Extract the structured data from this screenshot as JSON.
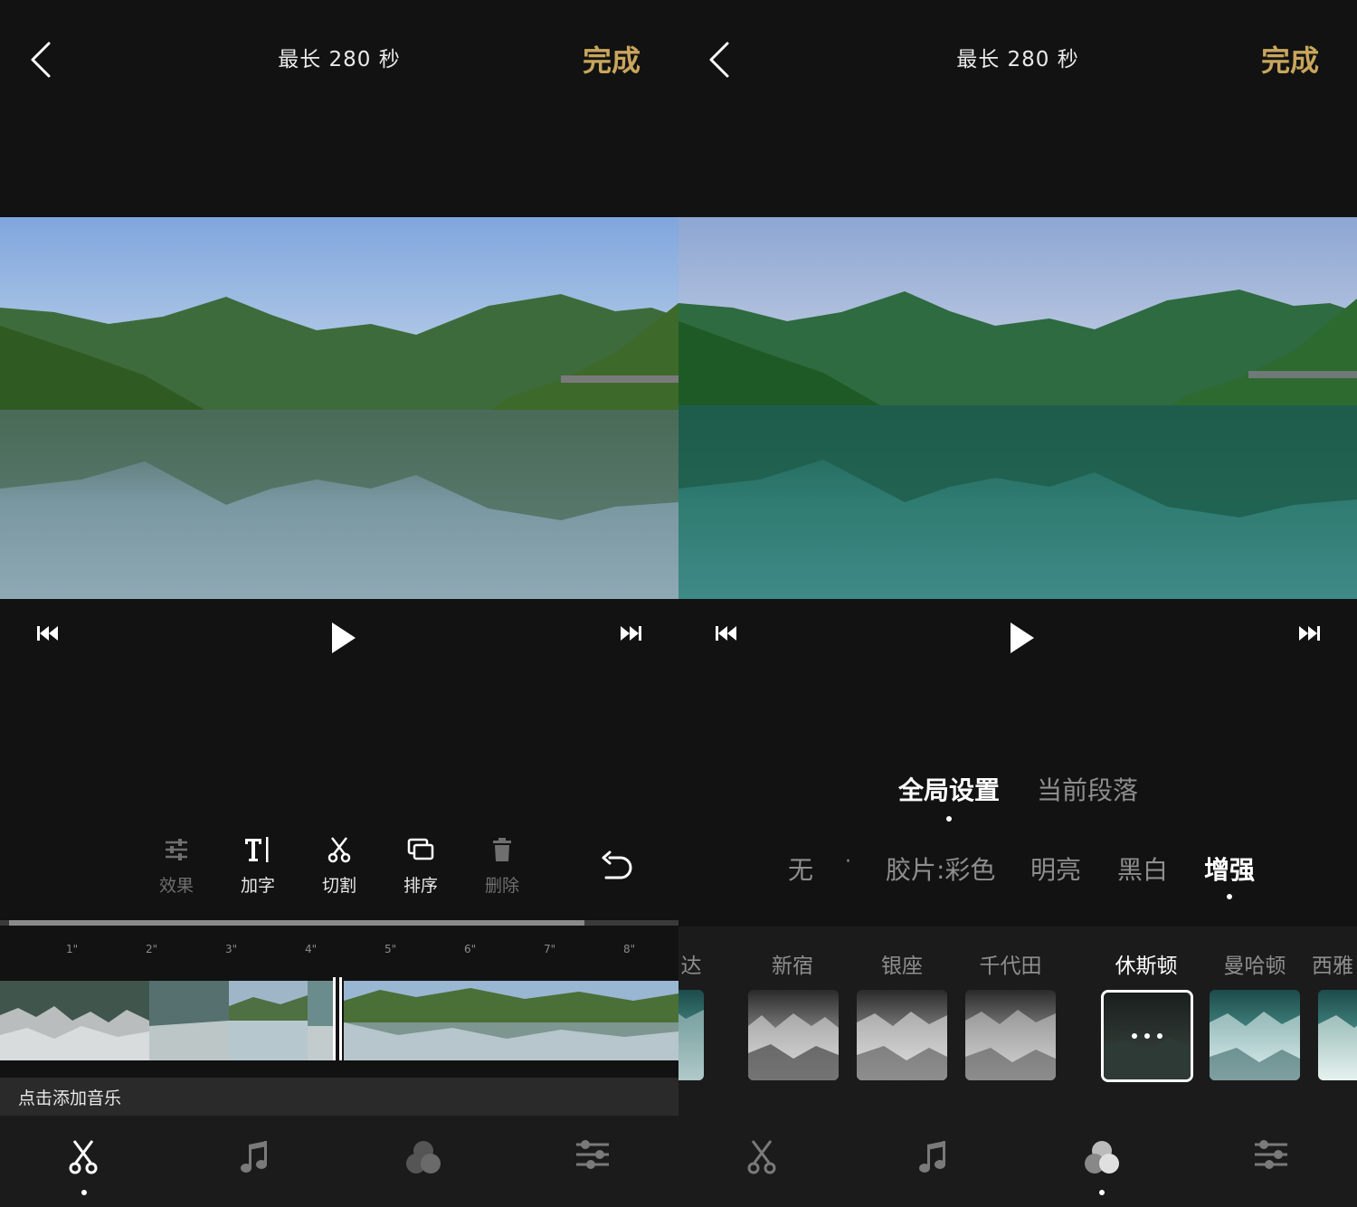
{
  "header": {
    "title": "最长 280 秒",
    "done_label": "完成"
  },
  "editor": {
    "tools": [
      {
        "label": "效果",
        "icon": "sliders-icon",
        "enabled": false
      },
      {
        "label": "加字",
        "icon": "text-cursor-icon",
        "enabled": true
      },
      {
        "label": "切割",
        "icon": "scissors-icon",
        "enabled": true
      },
      {
        "label": "排序",
        "icon": "layers-icon",
        "enabled": true
      },
      {
        "label": "删除",
        "icon": "trash-icon",
        "enabled": false
      }
    ],
    "undo_icon": "undo-icon",
    "timeline": {
      "progress_fraction": 0.86,
      "ruler_ticks": [
        "1\"",
        "2\"",
        "3\"",
        "4\"",
        "5\"",
        "6\"",
        "7\"",
        "8\""
      ]
    },
    "music_hint": "点击添加音乐"
  },
  "filter": {
    "scope_tabs": [
      {
        "label": "全局设置",
        "active": true
      },
      {
        "label": "当前段落",
        "active": false
      }
    ],
    "categories": [
      {
        "label": "无",
        "active": false
      },
      {
        "label": "胶片:彩色",
        "active": false
      },
      {
        "label": "明亮",
        "active": false
      },
      {
        "label": "黑白",
        "active": false
      },
      {
        "label": "增强",
        "active": true
      }
    ],
    "category_separator": "·",
    "presets": [
      {
        "name": "达",
        "active": false
      },
      {
        "name": "新宿",
        "active": false
      },
      {
        "name": "银座",
        "active": false
      },
      {
        "name": "千代田",
        "active": false
      },
      {
        "name": "休斯顿",
        "active": true
      },
      {
        "name": "曼哈顿",
        "active": false
      },
      {
        "name": "西雅",
        "active": false
      }
    ]
  },
  "bottom_nav": [
    {
      "icon": "scissors-icon"
    },
    {
      "icon": "music-note-icon"
    },
    {
      "icon": "color-filter-icon"
    },
    {
      "icon": "adjust-sliders-icon"
    }
  ],
  "colors": {
    "background": "#121212",
    "accent_gold": "#c9a65c",
    "bar_background": "#1b1b1b",
    "muted_text": "#8e8e8e"
  }
}
